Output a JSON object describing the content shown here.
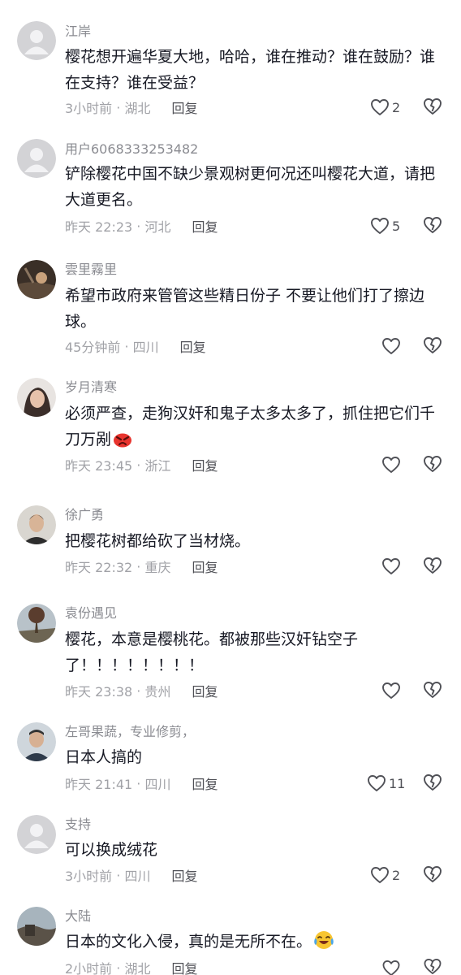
{
  "comments": [
    {
      "user": "江岸",
      "text": "樱花想开遍华夏大地，哈哈，谁在推动？谁在鼓励？谁在支持？谁在受益？",
      "time": "3小时前",
      "location": "湖北",
      "reply_label": "回复",
      "likes": "2",
      "avatar": "default"
    },
    {
      "user": "用户6068333253482",
      "text": "铲除樱花中国不缺少景观树更何况还叫樱花大道，请把大道更名。",
      "time": "昨天 22:23",
      "location": "河北",
      "reply_label": "回复",
      "likes": "5",
      "avatar": "default"
    },
    {
      "user": "雲里霧里",
      "text": "希望市政府来管管这些精日份子   不要让他们打了擦边球。",
      "time": "45分钟前",
      "location": "四川",
      "reply_label": "回复",
      "likes": "",
      "avatar": "photo-dark"
    },
    {
      "user": "岁月清寒",
      "text": "必须严查，走狗汉奸和鬼子太多太多了，抓住把它们千刀万剐",
      "emoji": "angry-face-emoji",
      "time": "昨天 23:45",
      "location": "浙江",
      "reply_label": "回复",
      "likes": "",
      "avatar": "photo-woman"
    },
    {
      "user": "徐广勇",
      "text": "把樱花树都给砍了当材烧。",
      "time": "昨天 22:32",
      "location": "重庆",
      "reply_label": "回复",
      "likes": "",
      "avatar": "photo-man"
    },
    {
      "user": "袁份遇见",
      "text": "樱花，本意是樱桃花。都被那些汉奸钻空子了！！！！！！！！",
      "time": "昨天 23:38",
      "location": "贵州",
      "reply_label": "回复",
      "likes": "",
      "avatar": "photo-tree"
    },
    {
      "user": "左哥果蔬，专业修剪，",
      "text": "日本人搞的",
      "time": "昨天 21:41",
      "location": "四川",
      "reply_label": "回复",
      "likes": "11",
      "avatar": "photo-person"
    },
    {
      "user": "支持",
      "text": "可以换成绒花",
      "time": "3小时前",
      "location": "四川",
      "reply_label": "回复",
      "likes": "2",
      "avatar": "default"
    },
    {
      "user": "大陆",
      "text": "日本的文化入侵，真的是无所不在。",
      "emoji": "crying-laughing-emoji",
      "time": "2小时前",
      "location": "湖北",
      "reply_label": "回复",
      "likes": "",
      "avatar": "photo-landscape"
    }
  ],
  "colors": {
    "username": "#8a8b91",
    "text": "#161823",
    "meta": "#a1a2a7",
    "reply": "#4f5056",
    "icon": "#4f5056"
  }
}
